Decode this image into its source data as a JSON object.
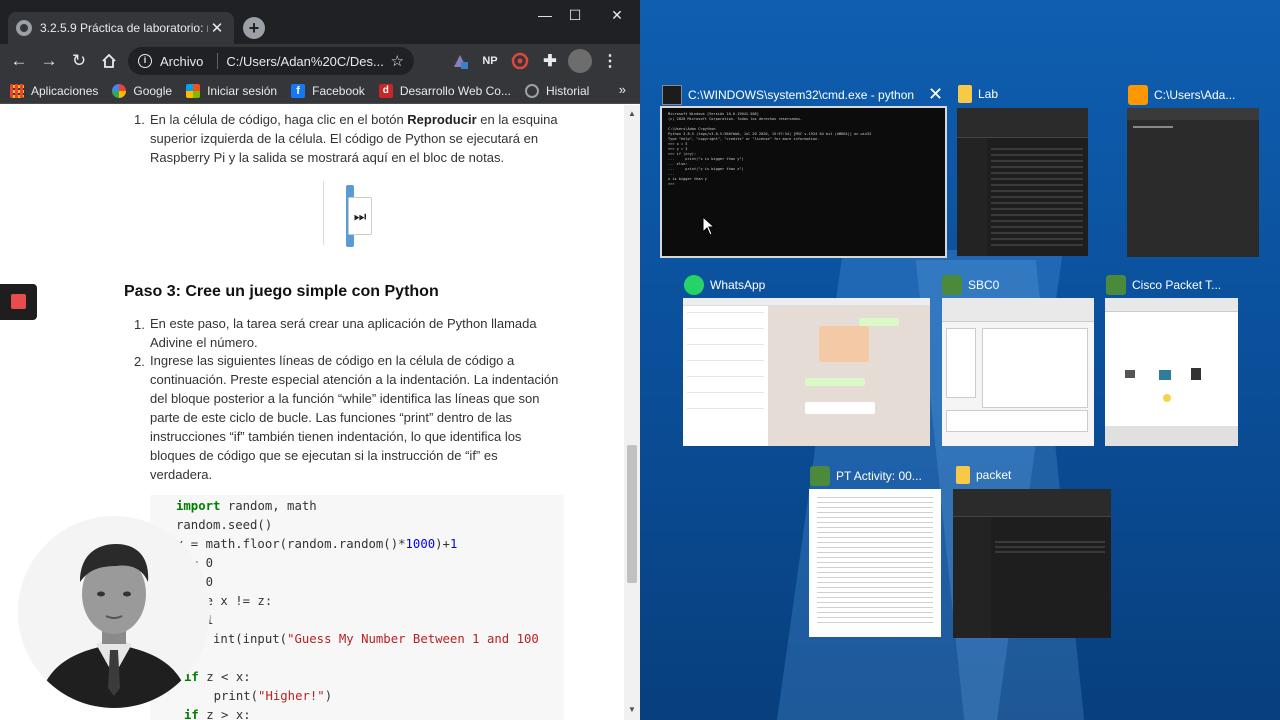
{
  "browser": {
    "tab_title": "3.2.5.9 Práctica de laboratorio: re",
    "new_tab": "+",
    "window_controls": {
      "minimize": "—",
      "maximize": "☐",
      "close": "✕"
    },
    "omnibox": {
      "scheme": "Archivo",
      "url": "C:/Users/Adan%20C/Des..."
    },
    "extensions": [
      "NP"
    ],
    "bookmarks": [
      {
        "label": "Aplicaciones",
        "icon": "apps-grid-icon",
        "color": "#ea4335"
      },
      {
        "label": "Google",
        "icon": "google-icon",
        "color": "#4285f4"
      },
      {
        "label": "Iniciar sesión",
        "icon": "office-icon",
        "color": "#eb3c00"
      },
      {
        "label": "Facebook",
        "icon": "facebook-icon",
        "color": "#1877f2"
      },
      {
        "label": "Desarrollo Web Co...",
        "icon": "red-logo-icon",
        "color": "#c62828"
      },
      {
        "label": "Historial",
        "icon": "history-icon",
        "color": "#9aa0a6"
      }
    ],
    "bookmarks_more": "»"
  },
  "content": {
    "item1_num": "1.",
    "item1_line1_a": "En la célula de código, haga clic en el botón ",
    "item1_line1_b": "Reproducir",
    "item1_line1_c": " en la esquina",
    "item1_line2": "superior izquierda de la célula. El código de Python se ejecutará en",
    "item1_line3": "Raspberry Pi y la salida se mostrará aquí en el bloc de notas.",
    "play_glyph": "⏭",
    "heading": "Paso 3: Cree un juego simple con Python",
    "s1_num": "1.",
    "s1_line1": "En este paso, la tarea será crear una aplicación de Python llamada",
    "s1_line2": "Adivine el número.",
    "s2_num": "2.",
    "s2_lines": [
      "Ingrese las siguientes líneas de código en la célula de código a",
      "continuación. Preste especial atención a la indentación. La indentación",
      "del bloque posterior a la función “while” identifica las líneas que son",
      "parte de este ciclo de bucle. Las funciones “print” dentro de las",
      "instrucciones “if” también tienen indentación, lo que identifica los",
      "bloques de código que se ejecutan si la instrucción de “if” es",
      "verdadera."
    ],
    "code": {
      "l1_kw": "import",
      "l1_rest": " random, math",
      "l2": "random.seed()",
      "l3_a": "x = math.floor(random.random()*",
      "l3_n1": "1000",
      "l3_b": ")+",
      "l3_n2": "1",
      "l4": "  = 0",
      "l5": "  = 0",
      "l6": "    e x != z:",
      "l7": "   +1",
      "l8_a": "   = int(input(",
      "l8_s": "\"Guess My Number Between 1 and 100",
      "l9_s": "\"",
      "l9_b": "))",
      "l10_kw": "if",
      "l10_rest": " z < x:",
      "l11_a": "    print(",
      "l11_s": "\"Higher!\"",
      "l11_b": ")",
      "l12_kw": "if",
      "l12_rest": " z > x:"
    }
  },
  "taskview": {
    "windows": [
      {
        "title": "C:\\WINDOWS\\system32\\cmd.exe - python",
        "icon": "cmd-icon"
      },
      {
        "title": "Lab",
        "icon": "folder-icon"
      },
      {
        "title": "C:\\Users\\Ada...",
        "icon": "sublime-icon"
      },
      {
        "title": "WhatsApp",
        "icon": "whatsapp-icon"
      },
      {
        "title": "SBC0",
        "icon": "packet-tracer-icon"
      },
      {
        "title": "Cisco Packet T...",
        "icon": "packet-tracer-icon"
      },
      {
        "title": "PT Activity: 00...",
        "icon": "packet-tracer-icon"
      },
      {
        "title": "packet",
        "icon": "folder-icon"
      }
    ],
    "close": "✕",
    "cmd_lines": [
      "Microsoft Windows [Versión 10.0.19041.508]",
      "(c) 2020 Microsoft Corporation. Todos los derechos reservados.",
      "",
      "C:\\Users\\Adan C>python",
      "Python 3.8.5 (tags/v3.8.5:580fbb0, Jul 20 2020, 15:57:54) [MSC v.1924 64 bit (AMD64)] on win32",
      "Type \"help\", \"copyright\", \"credits\" or \"license\" for more information.",
      ">>> x = 5",
      ">>> y = 3",
      ">>> if (x>y):",
      "...     print(\"x is bigger than y\")",
      "... else:",
      "...     print(\"y is bigger than x\")",
      "...",
      "x is bigger than y",
      ">>>"
    ]
  },
  "colors": {
    "accent": "#1a73e8",
    "taskview_bg": "#0a4f9a",
    "record": "#e84c4c"
  }
}
